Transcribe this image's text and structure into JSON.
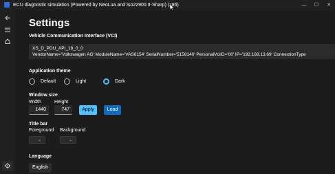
{
  "window": {
    "title": "ECU diagnostic simulation (Powered by NeoLua and Iso22900.II-Sharp) (x86)",
    "controls": {
      "minimize": "—",
      "maximize": "☐",
      "close": "✕"
    }
  },
  "rail": {
    "items": [
      {
        "name": "back",
        "icon": "back-arrow-icon"
      },
      {
        "name": "menu",
        "icon": "hamburger-icon"
      },
      {
        "name": "home",
        "icon": "home-icon"
      },
      {
        "name": "settings",
        "icon": "gear-icon",
        "selected": true
      }
    ]
  },
  "page": {
    "title": "Settings",
    "vci": {
      "heading": "Vehicle Communication Interface (VCI)",
      "line1": "XS_D_PDU_API_18_0_0",
      "line2": "VendorName='Volkswagen AG' ModuleName='VAS6154' SerialNumber='5158140' PersonalVciID='00' IP='192.168.13.69' ConnectionType"
    },
    "theme": {
      "heading": "Application theme",
      "options": [
        "Default",
        "Light",
        "Dark"
      ],
      "selected": "Dark"
    },
    "window_size": {
      "heading": "Window size",
      "width_label": "Width",
      "height_label": "Height",
      "width_value": "1440",
      "height_value": "747",
      "apply_label": "Apply",
      "load_label": "Load"
    },
    "title_bar": {
      "heading": "Title bar",
      "foreground_label": "Foreground",
      "background_label": "Background"
    },
    "language": {
      "heading": "Language",
      "value": "English"
    }
  },
  "colors": {
    "accent": "#4cc2ff",
    "accent_dark": "#0f6cbd",
    "background": "#1c1c1c"
  }
}
